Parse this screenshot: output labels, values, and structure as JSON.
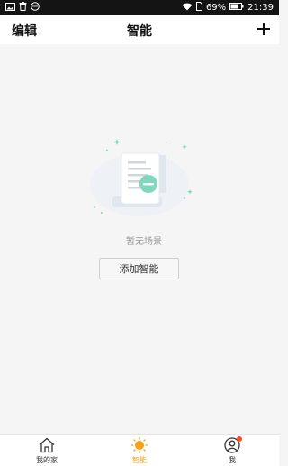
{
  "status_bar": {
    "battery": "69%",
    "time": "21:39"
  },
  "header": {
    "edit_label": "编辑",
    "title": "智能",
    "add_icon": "plus-icon"
  },
  "empty_state": {
    "message": "暂无场景",
    "button_label": "添加智能",
    "illustration": "empty-document-illustration"
  },
  "tabbar": {
    "items": [
      {
        "label": "我的家",
        "icon": "home-icon",
        "active": false
      },
      {
        "label": "智能",
        "icon": "sun-icon",
        "active": true
      },
      {
        "label": "我",
        "icon": "profile-icon",
        "active": false,
        "badge": true
      }
    ]
  },
  "colors": {
    "accent": "#f5a017",
    "badge": "#ff4a1a",
    "teal": "#6fd3b6"
  }
}
